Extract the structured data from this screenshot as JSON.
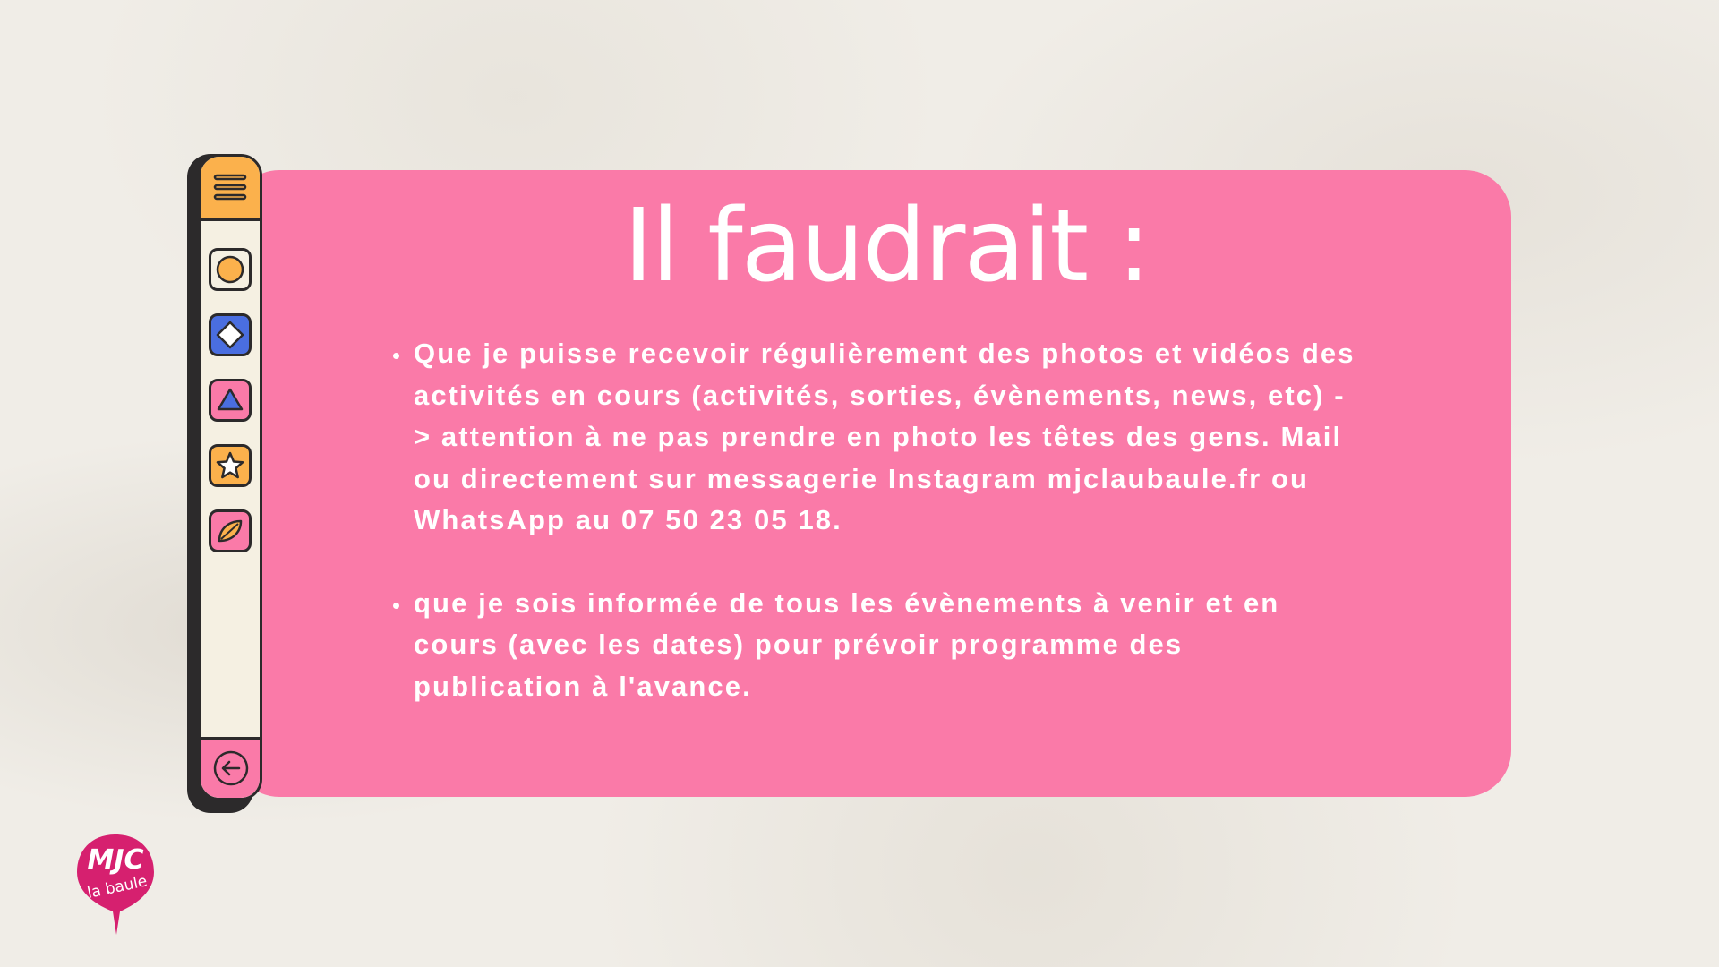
{
  "title": "Il faudrait :",
  "bullets": [
    "Que je puisse recevoir régulièrement des photos et vidéos des activités en cours (activités, sorties, évènements, news, etc) -> attention à ne pas prendre en photo les têtes des gens. Mail ou directement sur messagerie Instagram mjclaubaule.fr ou WhatsApp au 07 50 23 05 18.",
    "que je sois informée de tous les évènements à venir et en cours (avec les dates) pour prévoir programme des publication à l'avance."
  ],
  "sidebar": {
    "top_icon": "menu-icon",
    "buttons": [
      {
        "icon": "circle-icon",
        "bg": "#f5f0e2",
        "fg": "#fbb14c"
      },
      {
        "icon": "diamond-icon",
        "bg": "#4a6ee0",
        "fg": "#ffffff"
      },
      {
        "icon": "triangle-icon",
        "bg": "#fa7aa8",
        "fg": "#4a6ee0"
      },
      {
        "icon": "star-icon",
        "bg": "#fbb14c",
        "fg": "#ffffff"
      },
      {
        "icon": "leaf-icon",
        "bg": "#fa7aa8",
        "fg": "#fbb14c"
      }
    ],
    "bottom_icon": "back-arrow-icon"
  },
  "logo": {
    "text_main": "MJC",
    "text_sub": "la baule",
    "color": "#d6206f"
  },
  "colors": {
    "panel": "#fa7aa8",
    "background": "#f0ede7",
    "outline": "#2c2a2b",
    "accent_orange": "#fbb14c",
    "accent_blue": "#4a6ee0"
  }
}
